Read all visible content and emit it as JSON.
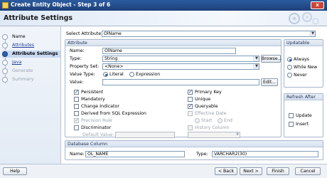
{
  "window": {
    "title": "Create Entity Object - Step 3 of 6",
    "close_label": "x"
  },
  "header": {
    "title": "Attribute Settings"
  },
  "nav": {
    "items": [
      {
        "label": "Name",
        "state": "done"
      },
      {
        "label": "Attributes",
        "state": "link"
      },
      {
        "label": "Attribute Settings",
        "state": "current"
      },
      {
        "label": "Java",
        "state": "link"
      },
      {
        "label": "Generate",
        "state": "todo"
      },
      {
        "label": "Summary",
        "state": "todo"
      }
    ]
  },
  "select_attribute": {
    "label": "Select Attribute",
    "value": "OlName"
  },
  "attribute": {
    "group_title": "Attribute",
    "name_label": "Name:",
    "name_value": "OlName",
    "type_label": "Type:",
    "type_value": "String",
    "browse_label": "Browse...",
    "property_set_label": "Property Set:",
    "property_set_value": "<None>",
    "value_type_label": "Value Type:",
    "literal_label": "Literal",
    "expression_label": "Expression",
    "value_label": "Value:",
    "value_value": "",
    "edit_label": "Edit...",
    "checks_left": [
      {
        "label": "Persistent",
        "checked": true,
        "disabled": false
      },
      {
        "label": "Mandatory",
        "checked": false,
        "disabled": false
      },
      {
        "label": "Change Indicator",
        "checked": false,
        "disabled": false
      },
      {
        "label": "Derived from SQL Expression",
        "checked": false,
        "disabled": false
      },
      {
        "label": "Precision Rule",
        "checked": true,
        "disabled": true
      },
      {
        "label": "Discriminator",
        "checked": false,
        "disabled": false
      }
    ],
    "default_value_label": "Default Value:",
    "checks_right": [
      {
        "label": "Primary Key",
        "checked": true,
        "disabled": false
      },
      {
        "label": "Unique",
        "checked": false,
        "disabled": false
      },
      {
        "label": "Queryable",
        "checked": true,
        "disabled": false
      },
      {
        "label": "Effective Date",
        "checked": false,
        "disabled": true
      }
    ],
    "start_label": "Start",
    "end_label": "End",
    "history_column_label": "History Column"
  },
  "updatable": {
    "title": "Updatable",
    "options": [
      "Always",
      "While New",
      "Never"
    ],
    "selected": "Always"
  },
  "refresh_after": {
    "title": "Refresh After",
    "options": [
      "Update",
      "Insert"
    ]
  },
  "database_column": {
    "title": "Database Column",
    "name_label": "Name:",
    "name_value": "OL_NAME",
    "type_label": "Type:",
    "type_value": "VARCHAR2(30)"
  },
  "footer": {
    "help": "Help",
    "back": "< Back",
    "next": "Next >",
    "finish": "Finish",
    "cancel": "Cancel"
  }
}
